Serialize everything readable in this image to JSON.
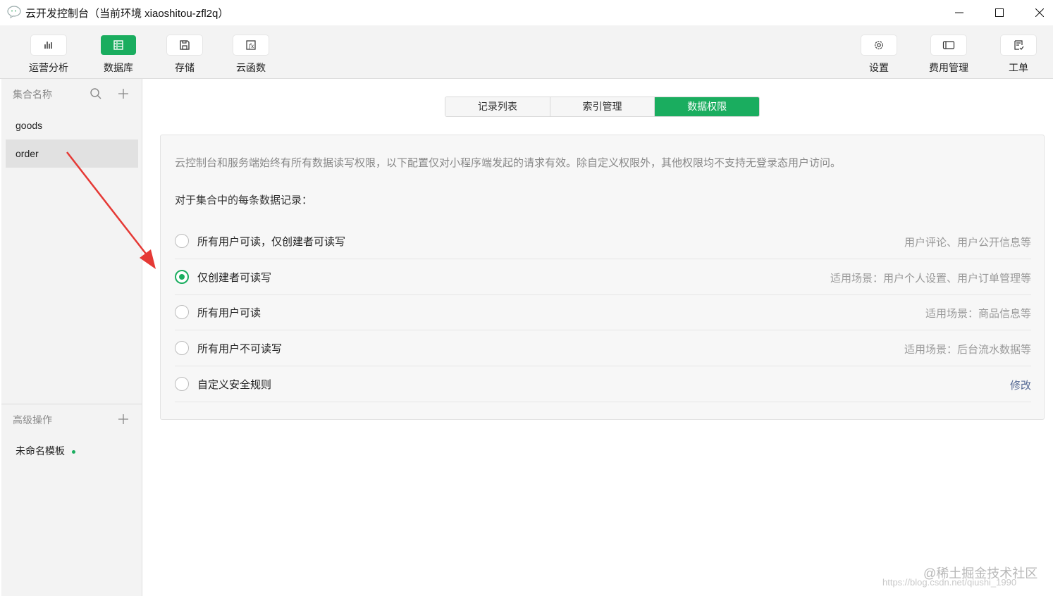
{
  "window": {
    "title": "云开发控制台（当前环境 xiaoshitou-zfl2q）"
  },
  "toolbar": {
    "left": [
      {
        "label": "运营分析",
        "icon": "bar-chart-icon"
      },
      {
        "label": "数据库",
        "icon": "database-icon",
        "active": true
      },
      {
        "label": "存储",
        "icon": "floppy-disk-icon"
      },
      {
        "label": "云函数",
        "icon": "function-icon"
      }
    ],
    "right": [
      {
        "label": "设置",
        "icon": "gear-icon"
      },
      {
        "label": "费用管理",
        "icon": "billing-icon"
      },
      {
        "label": "工单",
        "icon": "ticket-icon"
      }
    ]
  },
  "sidebar": {
    "collections_header": "集合名称",
    "collections": [
      "goods",
      "order"
    ],
    "selected_collection": "order",
    "advanced_header": "高级操作",
    "template_item": "未命名模板"
  },
  "tabs": [
    "记录列表",
    "索引管理",
    "数据权限"
  ],
  "active_tab": "数据权限",
  "permissions": {
    "notice": "云控制台和服务端始终有所有数据读写权限，以下配置仅对小程序端发起的请求有效。除自定义权限外，其他权限均不支持无登录态用户访问。",
    "for_each": "对于集合中的每条数据记录：",
    "options": [
      {
        "label": "所有用户可读，仅创建者可读写",
        "hint": "用户评论、用户公开信息等",
        "checked": false
      },
      {
        "label": "仅创建者可读写",
        "hint": "适用场景：用户个人设置、用户订单管理等",
        "checked": true
      },
      {
        "label": "所有用户可读",
        "hint": "适用场景：商品信息等",
        "checked": false
      },
      {
        "label": "所有用户不可读写",
        "hint": "适用场景：后台流水数据等",
        "checked": false
      },
      {
        "label": "自定义安全规则",
        "hint": "修改",
        "checked": false
      }
    ]
  },
  "watermark": {
    "main": "@稀土掘金技术社区",
    "url": "https://blog.csdn.net/qiushi_1990"
  },
  "colors": {
    "accent": "#1aad5f",
    "annotation_arrow": "#e53935",
    "link": "#576b95"
  }
}
